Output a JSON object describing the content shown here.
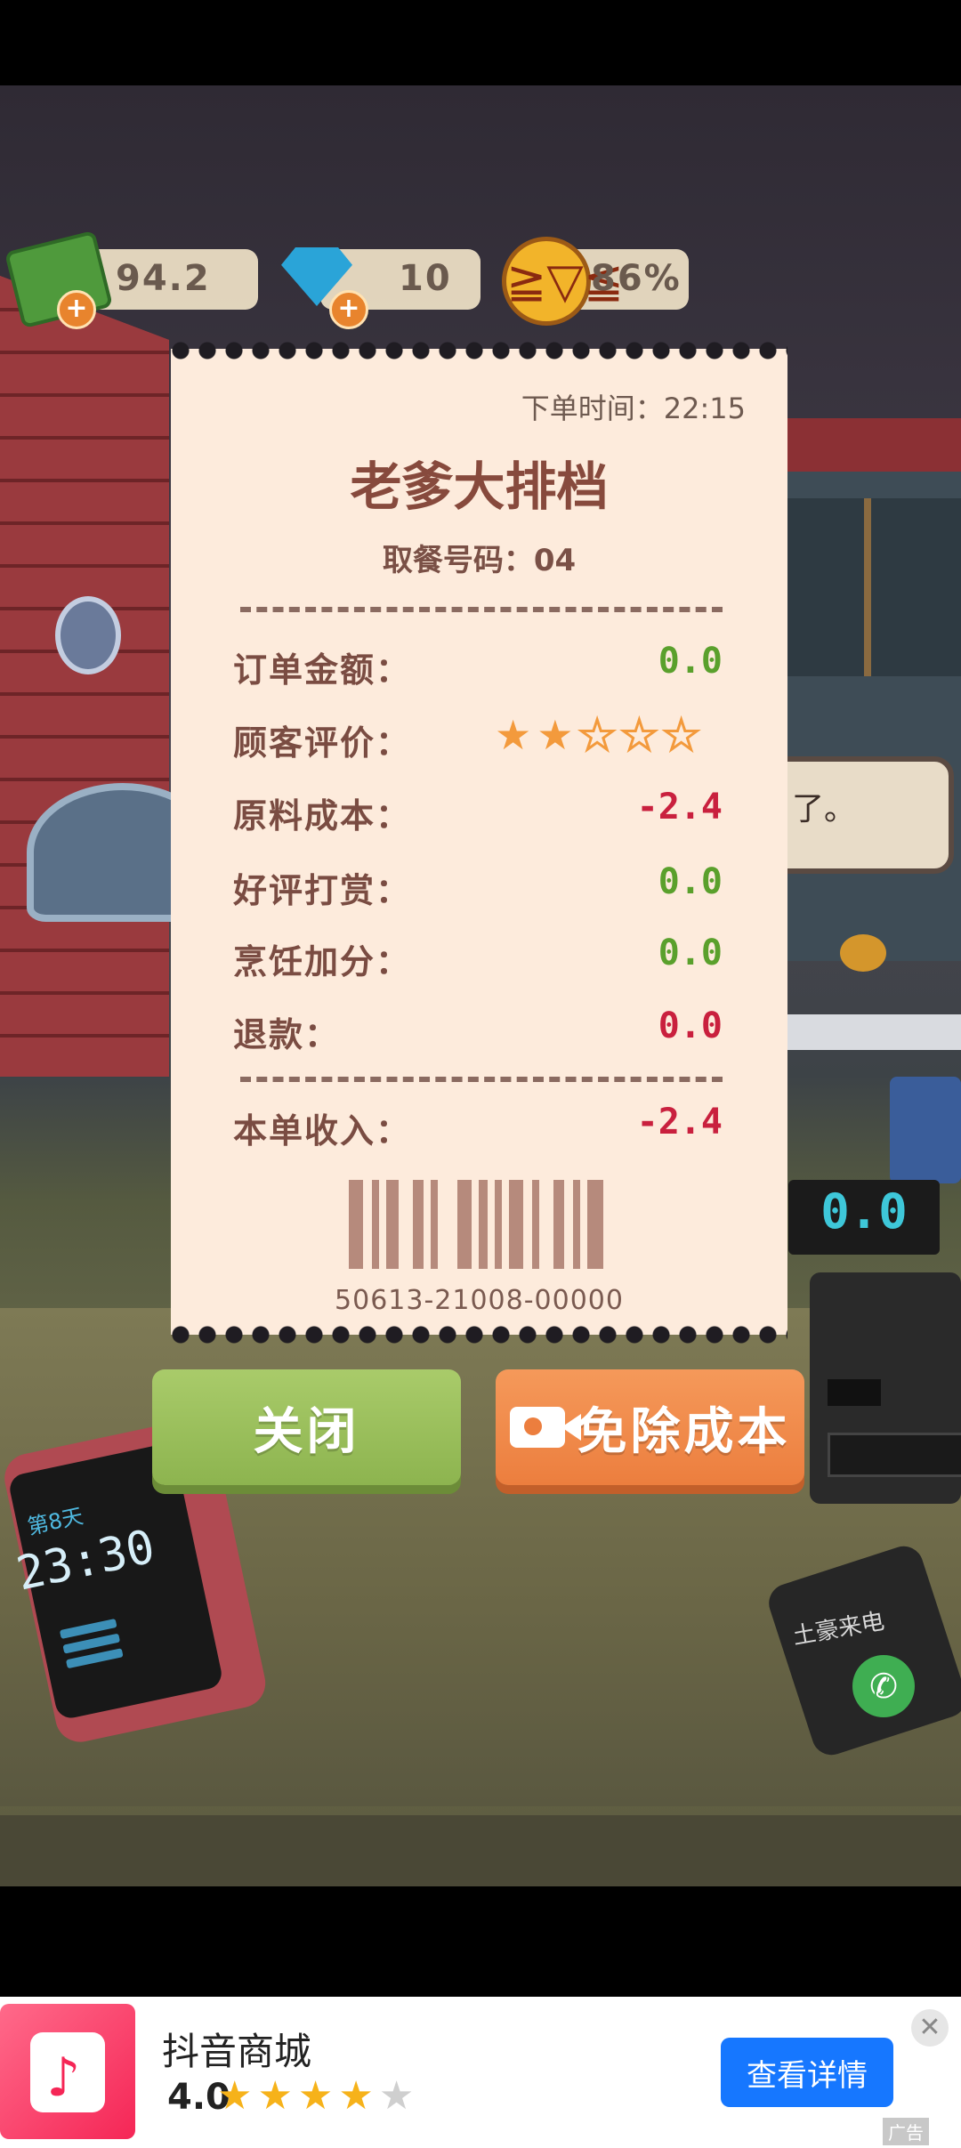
{
  "resources": {
    "cash": "94.2",
    "gems": "10",
    "satisfaction": "86%",
    "plus_glyph": "+"
  },
  "receipt": {
    "order_time": "下单时间：22:15",
    "shop_name": "老爹大排档",
    "pickup_code": "取餐号码：04",
    "rows": [
      {
        "label": "订单金额：",
        "value": "0.0",
        "color": "#5aa02c"
      },
      {
        "label": "顾客评价：",
        "stars": 2,
        "max_stars": 5
      },
      {
        "label": "原料成本：",
        "value": "-2.4",
        "color": "#c9203e"
      },
      {
        "label": "好评打赏：",
        "value": "0.0",
        "color": "#5aa02c"
      },
      {
        "label": "烹饪加分：",
        "value": "0.0",
        "color": "#5aa02c"
      },
      {
        "label": "退款：",
        "value": "0.0",
        "color": "#c9203e"
      }
    ],
    "total_label": "本单收入：",
    "total_value": "-2.4",
    "barcode_number": "50613-21008-00000"
  },
  "buttons": {
    "close": "关闭",
    "waive_cost": "免除成本"
  },
  "scene": {
    "scale_display": "0.0",
    "speech_text": "了。",
    "tablet_day": "第8天",
    "tablet_time": "23:30",
    "phone_label": "土豪来电",
    "phone_icon": "phone-icon"
  },
  "ad": {
    "app_name": "抖音商城",
    "rating": "4.0",
    "stars_filled": 4,
    "stars_total": 5,
    "cta": "查看详情",
    "tag": "广告",
    "close_glyph": "✕"
  }
}
